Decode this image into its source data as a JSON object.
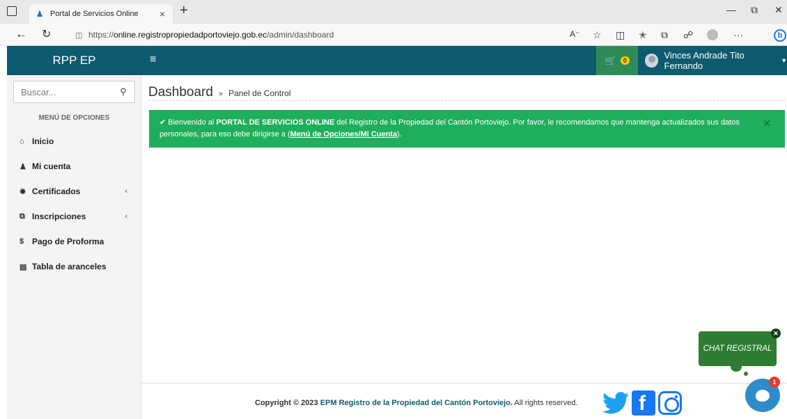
{
  "browser": {
    "tab_title": "Portal de Servicios Online",
    "url_prefix": "https://",
    "url_host": "online.registropropiedadportoviejo.gob.ec",
    "url_path": "/admin/dashboard"
  },
  "header": {
    "brand": "RPP EP",
    "cart_count": "0",
    "user_name": "Vinces Andrade Tito Fernando"
  },
  "sidebar": {
    "search_placeholder": "Buscar...",
    "menu_header": "MENÚ DE OPCIONES",
    "items": [
      {
        "label": "Inicio",
        "icon": "home-icon"
      },
      {
        "label": "Mi cuenta",
        "icon": "user-icon"
      },
      {
        "label": "Certificados",
        "icon": "certificate-icon",
        "has_submenu": true
      },
      {
        "label": "Inscripciones",
        "icon": "copy-icon",
        "has_submenu": true
      },
      {
        "label": "Pago de Proforma",
        "icon": "dollar-icon"
      },
      {
        "label": "Tabla de aranceles",
        "icon": "list-icon"
      }
    ]
  },
  "main": {
    "title": "Dashboard",
    "subtitle": "Panel de Control",
    "alert": {
      "prefix": "Bienvenido al",
      "bold": "PORTAL DE SERVICIOS ONLINE",
      "middle": "del Registro de la Propiedad del Cantón Portoviejo. Por favor, le recomendamos que mantenga actualizados sus datos personales, para eso debe dirigirse a (",
      "link": "Menú de Opciones/Mi Cuenta",
      "suffix": ")."
    }
  },
  "footer": {
    "copyright": "Copyright © 2023",
    "org": "EPM Registro de la Propiedad del Cantón Portoviejo.",
    "rights": "All rights reserved."
  },
  "chat": {
    "label": "CHAT REGISTRAL",
    "badge": "1"
  },
  "colors": {
    "header_bg": "#0e5a6e",
    "alert_bg": "#1fae5c",
    "cart_bg": "#2e8b57",
    "chat_bg": "#2e7d32"
  }
}
